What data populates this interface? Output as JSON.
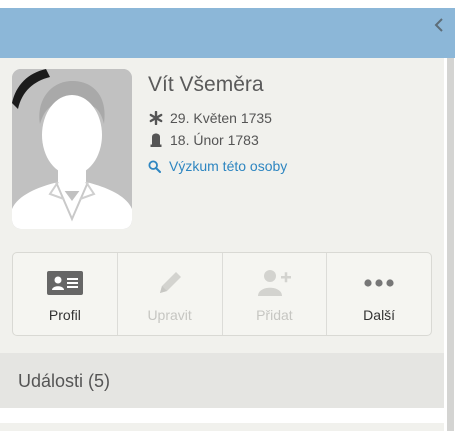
{
  "person": {
    "name": "Vít Všeměra",
    "birth": "29. Květen 1735",
    "death": "18. Únor 1783",
    "research_link": "Výzkum této osoby"
  },
  "actions": [
    {
      "label": "Profil",
      "icon": "id-card-icon",
      "enabled": true
    },
    {
      "label": "Upravit",
      "icon": "pencil-icon",
      "enabled": false
    },
    {
      "label": "Přidat",
      "icon": "add-person-icon",
      "enabled": false
    },
    {
      "label": "Další",
      "icon": "more-dots-icon",
      "enabled": true
    }
  ],
  "events": {
    "title": "Události (5)"
  },
  "colors": {
    "header": "#8cb7d8",
    "panel": "#f1f1ed",
    "link": "#2e86c1",
    "disabled": "#c6c6c2"
  }
}
